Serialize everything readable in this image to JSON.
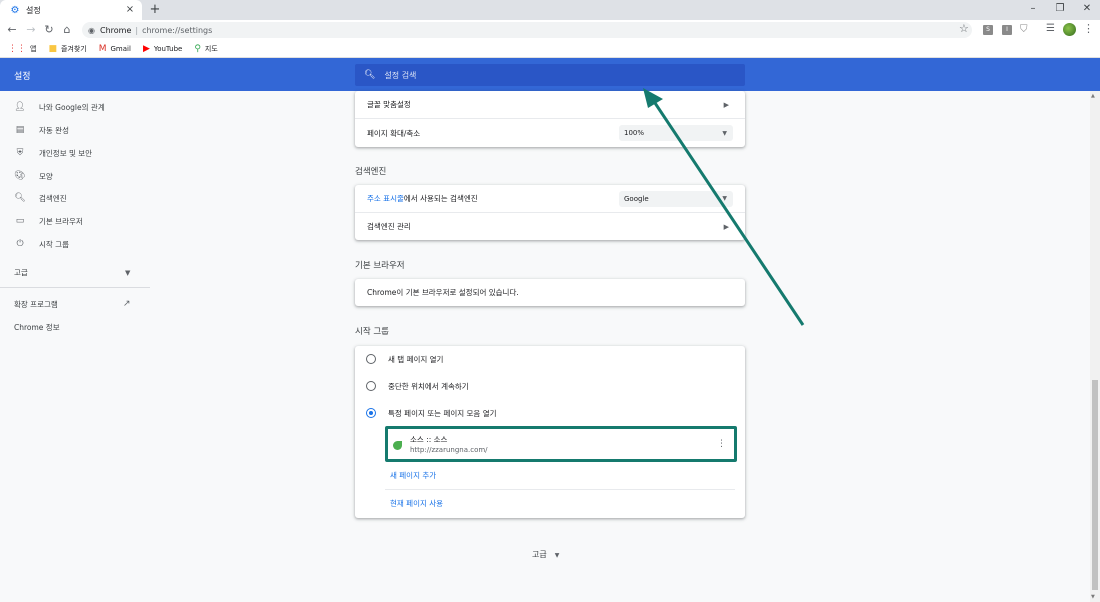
{
  "browser": {
    "tab_title": "설정",
    "tab_close": "×",
    "new_tab": "+",
    "window_minimize": "–",
    "window_restore": "❐",
    "window_close": "✕",
    "omnibox_host": "Chrome",
    "omnibox_separator": "|",
    "omnibox_path": "chrome://settings",
    "extensions": [
      "S",
      "I"
    ],
    "bookmarks": [
      {
        "label": "앱",
        "icon": "apps-grid-icon",
        "color": "#e53935"
      },
      {
        "label": "즐겨찾기",
        "icon": "folder-icon",
        "color": "#f9c642"
      },
      {
        "label": "Gmail",
        "icon": "gmail-icon",
        "color": "#d93025"
      },
      {
        "label": "YouTube",
        "icon": "youtube-icon",
        "color": "#ff0000"
      },
      {
        "label": "지도",
        "icon": "maps-pin-icon",
        "color": "#34a853"
      }
    ]
  },
  "header": {
    "title": "설정",
    "search_placeholder": "설정 검색",
    "color": "#3367d6"
  },
  "sidebar": {
    "items": [
      {
        "label": "나와 Google의 관계",
        "icon": "person-icon"
      },
      {
        "label": "자동 완성",
        "icon": "clipboard-icon"
      },
      {
        "label": "개인정보 및 보안",
        "icon": "shield-icon"
      },
      {
        "label": "모양",
        "icon": "palette-icon"
      },
      {
        "label": "검색엔진",
        "icon": "search-icon"
      },
      {
        "label": "기본 브라우저",
        "icon": "browser-window-icon"
      },
      {
        "label": "시작 그룹",
        "icon": "power-icon"
      }
    ],
    "advanced": "고급",
    "extensions": "확장 프로그램",
    "about": "Chrome 정보"
  },
  "appearance_card": {
    "font_customize": "글꼴 맞춤설정",
    "page_zoom_label": "페이지 확대/축소",
    "page_zoom_value": "100%"
  },
  "search_engine": {
    "section_title": "검색엔진",
    "address_bar_link": "주소 표시줄",
    "address_bar_rest": "에서 사용되는 검색엔진",
    "engine_value": "Google",
    "manage": "검색엔진 관리"
  },
  "default_browser": {
    "section_title": "기본 브라우저",
    "status": "Chrome이 기본 브라우저로 설정되어 있습니다."
  },
  "startup": {
    "section_title": "시작 그룹",
    "options": [
      {
        "label": "새 탭 페이지 열기",
        "selected": false
      },
      {
        "label": "중단한 위치에서 계속하기",
        "selected": false
      },
      {
        "label": "특정 페이지 또는 페이지 모음 열기",
        "selected": true
      }
    ],
    "page": {
      "title": "소스 :: 소스",
      "url": "http://zzarungna.com/"
    },
    "add_page": "새 페이지 추가",
    "use_current": "현재 페이지 사용"
  },
  "bottom_advanced": "고급",
  "annotation": {
    "color": "#157a6e"
  }
}
